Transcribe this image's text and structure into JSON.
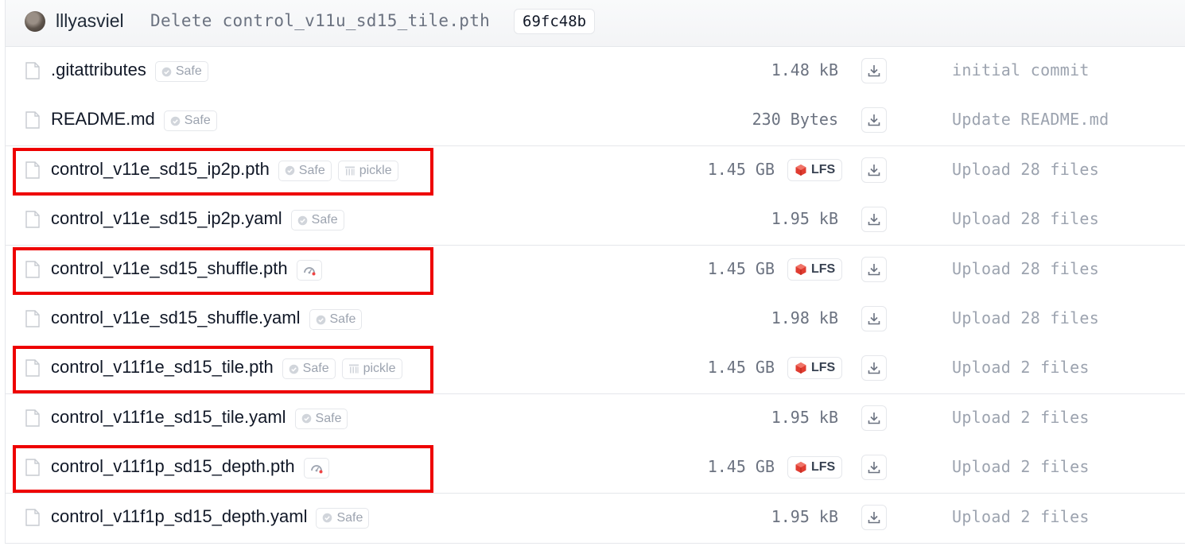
{
  "last_commit": {
    "author": "lllyasviel",
    "message": "Delete control_v11u_sd15_tile.pth",
    "hash": "69fc48b"
  },
  "files": [
    {
      "name": ".gitattributes",
      "badges": [
        {
          "label": "Safe",
          "icon": "shield-check-icon"
        }
      ],
      "size": "1.48 kB",
      "lfs": "",
      "commit": "initial commit",
      "highlighted": false
    },
    {
      "name": "README.md",
      "badges": [
        {
          "label": "Safe",
          "icon": "shield-check-icon"
        }
      ],
      "size": "230 Bytes",
      "lfs": "",
      "commit": "Update README.md",
      "highlighted": false
    },
    {
      "name": "control_v11e_sd15_ip2p.pth",
      "badges": [
        {
          "label": "Safe",
          "icon": "shield-check-icon"
        },
        {
          "label": "pickle",
          "icon": "pickle-icon"
        }
      ],
      "size": "1.45 GB",
      "lfs": "LFS",
      "commit": "Upload 28 files",
      "highlighted": true
    },
    {
      "name": "control_v11e_sd15_ip2p.yaml",
      "badges": [
        {
          "label": "Safe",
          "icon": "shield-check-icon"
        }
      ],
      "size": "1.95 kB",
      "lfs": "",
      "commit": "Upload 28 files",
      "highlighted": false
    },
    {
      "name": "control_v11e_sd15_shuffle.pth",
      "badges": [
        {
          "label": "",
          "icon": "scan-status-icon"
        }
      ],
      "size": "1.45 GB",
      "lfs": "LFS",
      "commit": "Upload 28 files",
      "highlighted": true
    },
    {
      "name": "control_v11e_sd15_shuffle.yaml",
      "badges": [
        {
          "label": "Safe",
          "icon": "shield-check-icon"
        }
      ],
      "size": "1.98 kB",
      "lfs": "",
      "commit": "Upload 28 files",
      "highlighted": false
    },
    {
      "name": "control_v11f1e_sd15_tile.pth",
      "badges": [
        {
          "label": "Safe",
          "icon": "shield-check-icon"
        },
        {
          "label": "pickle",
          "icon": "pickle-icon"
        }
      ],
      "size": "1.45 GB",
      "lfs": "LFS",
      "commit": "Upload 2 files",
      "highlighted": true
    },
    {
      "name": "control_v11f1e_sd15_tile.yaml",
      "badges": [
        {
          "label": "Safe",
          "icon": "shield-check-icon"
        }
      ],
      "size": "1.95 kB",
      "lfs": "",
      "commit": "Upload 2 files",
      "highlighted": false
    },
    {
      "name": "control_v11f1p_sd15_depth.pth",
      "badges": [
        {
          "label": "",
          "icon": "scan-status-icon"
        }
      ],
      "size": "1.45 GB",
      "lfs": "LFS",
      "commit": "Upload 2 files",
      "highlighted": true
    },
    {
      "name": "control_v11f1p_sd15_depth.yaml",
      "badges": [
        {
          "label": "Safe",
          "icon": "shield-check-icon"
        }
      ],
      "size": "1.95 kB",
      "lfs": "",
      "commit": "Upload 2 files",
      "highlighted": false
    }
  ],
  "colors": {
    "highlight": "#ee0000",
    "lfs_cube": "#e03c31",
    "muted_text": "#9ca3af"
  }
}
